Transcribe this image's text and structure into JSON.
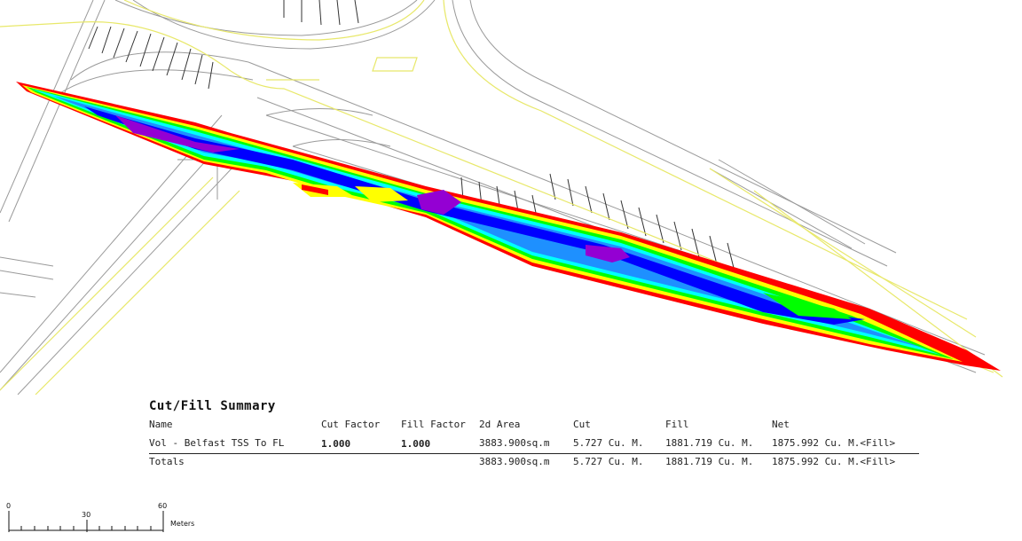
{
  "summary": {
    "title": "Cut/Fill Summary",
    "headers": {
      "name": "Name",
      "cut_factor": "Cut Factor",
      "fill_factor": "Fill Factor",
      "area": "2d Area",
      "cut": "Cut",
      "fill": "Fill",
      "net": "Net"
    },
    "row": {
      "name": "Vol - Belfast TSS To FL",
      "cut_factor": "1.000",
      "fill_factor": "1.000",
      "area": "3883.900sq.m",
      "cut": "5.727 Cu. M.",
      "fill": "1881.719 Cu. M.",
      "net": "1875.992 Cu. M.<Fill>"
    },
    "totals": {
      "label": "Totals",
      "area": "3883.900sq.m",
      "cut": "5.727 Cu. M.",
      "fill": "1881.719 Cu. M.",
      "net": "1875.992 Cu. M.<Fill>"
    }
  },
  "scale_bar": {
    "ticks": [
      "0",
      "30",
      "60"
    ],
    "unit": "Meters"
  },
  "colors": {
    "background": "#ffffff",
    "linework_gray": "#9a9a9a",
    "linework_yellow": "#e8e86a",
    "cut_fill_ramp": [
      "#ff0000",
      "#ffff00",
      "#00ff00",
      "#00ffff",
      "#1e90ff",
      "#0000ff",
      "#9400d3"
    ]
  }
}
